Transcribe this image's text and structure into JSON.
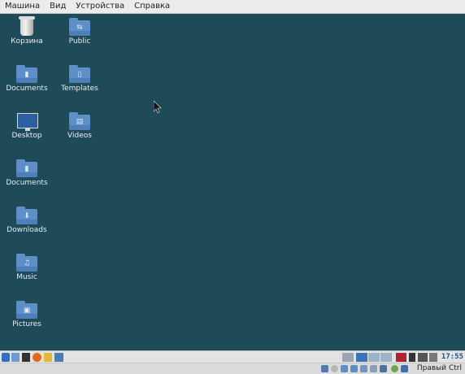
{
  "menubar": {
    "items": [
      "Машина",
      "Вид",
      "Устройства",
      "Справка"
    ]
  },
  "desktop": {
    "icons": [
      {
        "label": "Корзина",
        "icon": "trash-icon"
      },
      {
        "label": "Public",
        "icon": "folder-public-icon"
      },
      {
        "label": "Documents",
        "icon": "folder-documents-icon"
      },
      {
        "label": "Templates",
        "icon": "folder-templates-icon"
      },
      {
        "label": "Desktop",
        "icon": "desktop-icon"
      },
      {
        "label": "Videos",
        "icon": "folder-videos-icon"
      },
      {
        "label": "Documents",
        "icon": "folder-documents-icon"
      },
      {
        "label": "Downloads",
        "icon": "folder-downloads-icon"
      },
      {
        "label": "Music",
        "icon": "folder-music-icon"
      },
      {
        "label": "Pictures",
        "icon": "folder-pictures-icon"
      }
    ]
  },
  "taskbar": {
    "clock": "17:55"
  },
  "statusbar": {
    "host_key": "Правый Ctrl"
  },
  "colors": {
    "desktop_bg": "#1f4a58",
    "folder": "#5f8fc8",
    "menubar_bg": "#ececec"
  }
}
